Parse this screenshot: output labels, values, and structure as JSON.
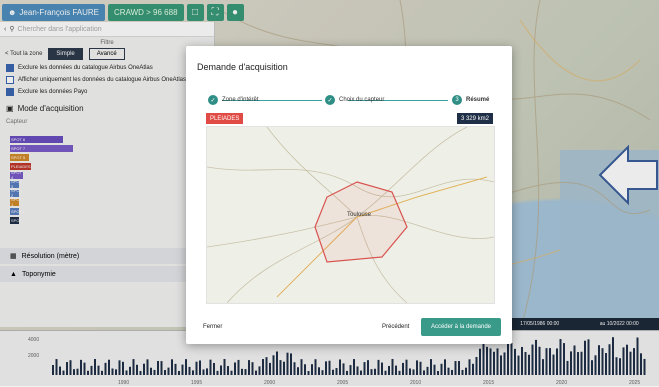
{
  "topbar": {
    "user_name": "Jean-François FAURE",
    "credits": "CRAWD > 96 688"
  },
  "panel": {
    "search_placeholder": "Chercher dans l'application",
    "filter_label": "Filtre",
    "back_label": "< Tout la zone",
    "tabs": [
      "Simple",
      "Avancé"
    ],
    "options": [
      {
        "label": "Exclure les données du catalogue Airbus OneAtlas",
        "checked": true
      },
      {
        "label": "Afficher uniquement les données du catalogue Airbus OneAtlas",
        "checked": false
      },
      {
        "label": "Exclure les données Payo",
        "checked": true
      }
    ],
    "section_mode": "Mode d'acquisition",
    "capteur_label": "Capteur",
    "sensor_bars": [
      {
        "label": "SPOT 6",
        "value": 0.52,
        "color": "#6a4fbf"
      },
      {
        "label": "SPOT 7",
        "value": 0.62,
        "color": "#7b5cc8"
      },
      {
        "label": "SPOT 5",
        "value": 0.18,
        "color": "#d38b2a"
      },
      {
        "label": "PLEIADES",
        "value": 0.2,
        "color": "#c0392b"
      },
      {
        "label": "SPOT 4",
        "value": 0.12,
        "color": "#7b5cc8"
      },
      {
        "label": "SPOT 3",
        "value": 0.06,
        "color": "#5a7fc0"
      },
      {
        "label": "SPOT 2",
        "value": 0.05,
        "color": "#5a7fc0"
      },
      {
        "label": "SPOT 1",
        "value": 0.04,
        "color": "#d38b2a"
      },
      {
        "label": "SPOT2",
        "value": 0.03,
        "color": "#5a7fc0"
      },
      {
        "label": "SPOT",
        "value": 0.02,
        "color": "#1f2f47"
      }
    ],
    "section_resolution": "Résolution (mètre)",
    "section_toponymie": "Toponymie"
  },
  "timeline": {
    "left_date": "17/05/1986 00:00",
    "right_date": "au 10/2022 00:00",
    "years": [
      "1990",
      "1995",
      "2000",
      "2005",
      "2010",
      "2015",
      "2020",
      "2025"
    ],
    "y_ticks": [
      "4000",
      "2000"
    ]
  },
  "modal": {
    "title": "Demande d'acquisition",
    "steps": [
      "Zone d'intérêt",
      "Choix du capteur",
      "Résumé"
    ],
    "step3_number": "3",
    "sensor_badge": "PLEIADES",
    "area_badge": "3 329 km2",
    "city_label": "Toulouse",
    "close_label": "Fermer",
    "prev_label": "Précédent",
    "submit_label": "Accéder à la demande"
  }
}
